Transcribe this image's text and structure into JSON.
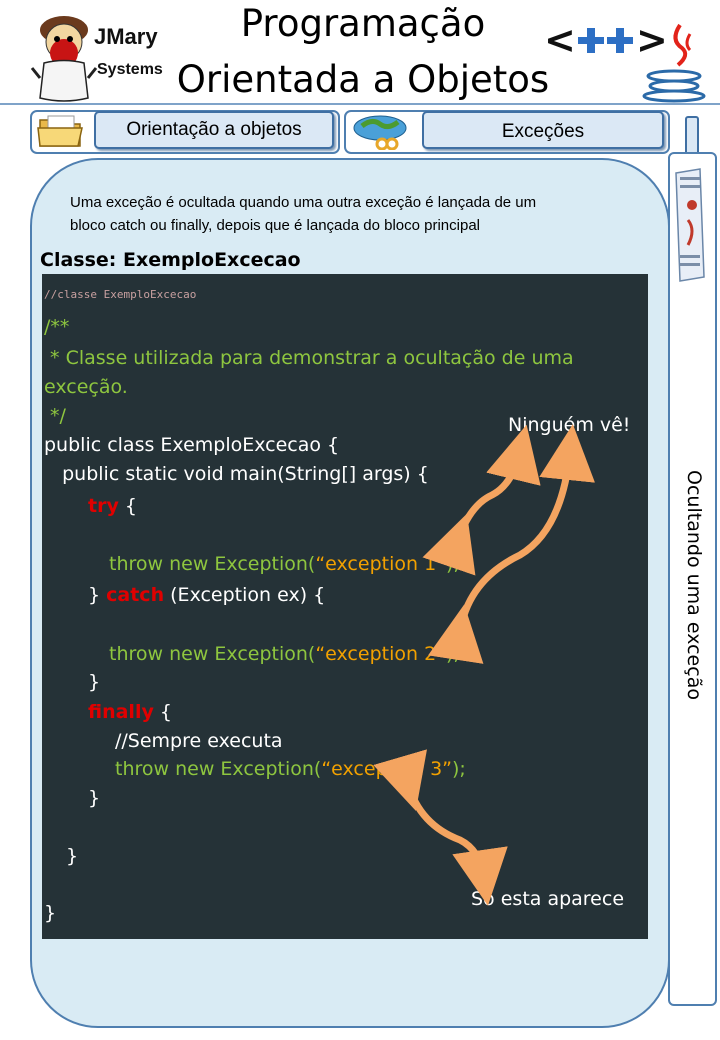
{
  "header": {
    "brand_line1": "JMary",
    "brand_line2": "Systems",
    "title_line1": "Programação",
    "title_line2": "Orientada a Objetos",
    "logo_text": "<++>"
  },
  "tabs": [
    {
      "label": "Orientação a objetos"
    },
    {
      "label": "Exceções"
    }
  ],
  "side": {
    "vertical_label": "Ocultando uma exceção"
  },
  "content": {
    "description_line1": "Uma exceção é ocultada quando uma outra exceção é lançada de um",
    "description_line2": "bloco catch ou finally, depois que é lançada do bloco principal",
    "class_heading": "Classe: ExemploExcecao",
    "code": {
      "comment_top": "//classe ExemploExcecao",
      "doc_open": "/**",
      "doc_line1": " * Classe utilizada para demonstrar a ocultação de uma",
      "doc_line2": "exceção.",
      "doc_close": " */",
      "class_decl": "public class ExemploExcecao {",
      "main_decl": "   public static void main(String[] args) {",
      "try_kw": "try",
      "try_brace": " {",
      "throw_prefix": "throw new Exception(",
      "ex1": "“exception 1”",
      "ex2": "“exception 2”",
      "ex3": "“exception 3”",
      "throw_suffix": ");",
      "close_brace_catch": "} ",
      "catch_kw": "catch",
      "catch_rest": " (Exception ex) {",
      "close_brace": "}",
      "finally_kw": "finally",
      "finally_brace": " {",
      "always_comment": "//Sempre executa"
    },
    "callout_top": "Ninguém vê!",
    "callout_bottom": "Só esta aparece"
  },
  "colors": {
    "accent_blue": "#4f7fb0",
    "panel_bg": "#d9ebf4",
    "code_bg": "#253237",
    "code_green": "#8ec63f",
    "code_orange": "#f2a100",
    "keyword_red": "#e00000",
    "arrow": "#f4a460"
  }
}
